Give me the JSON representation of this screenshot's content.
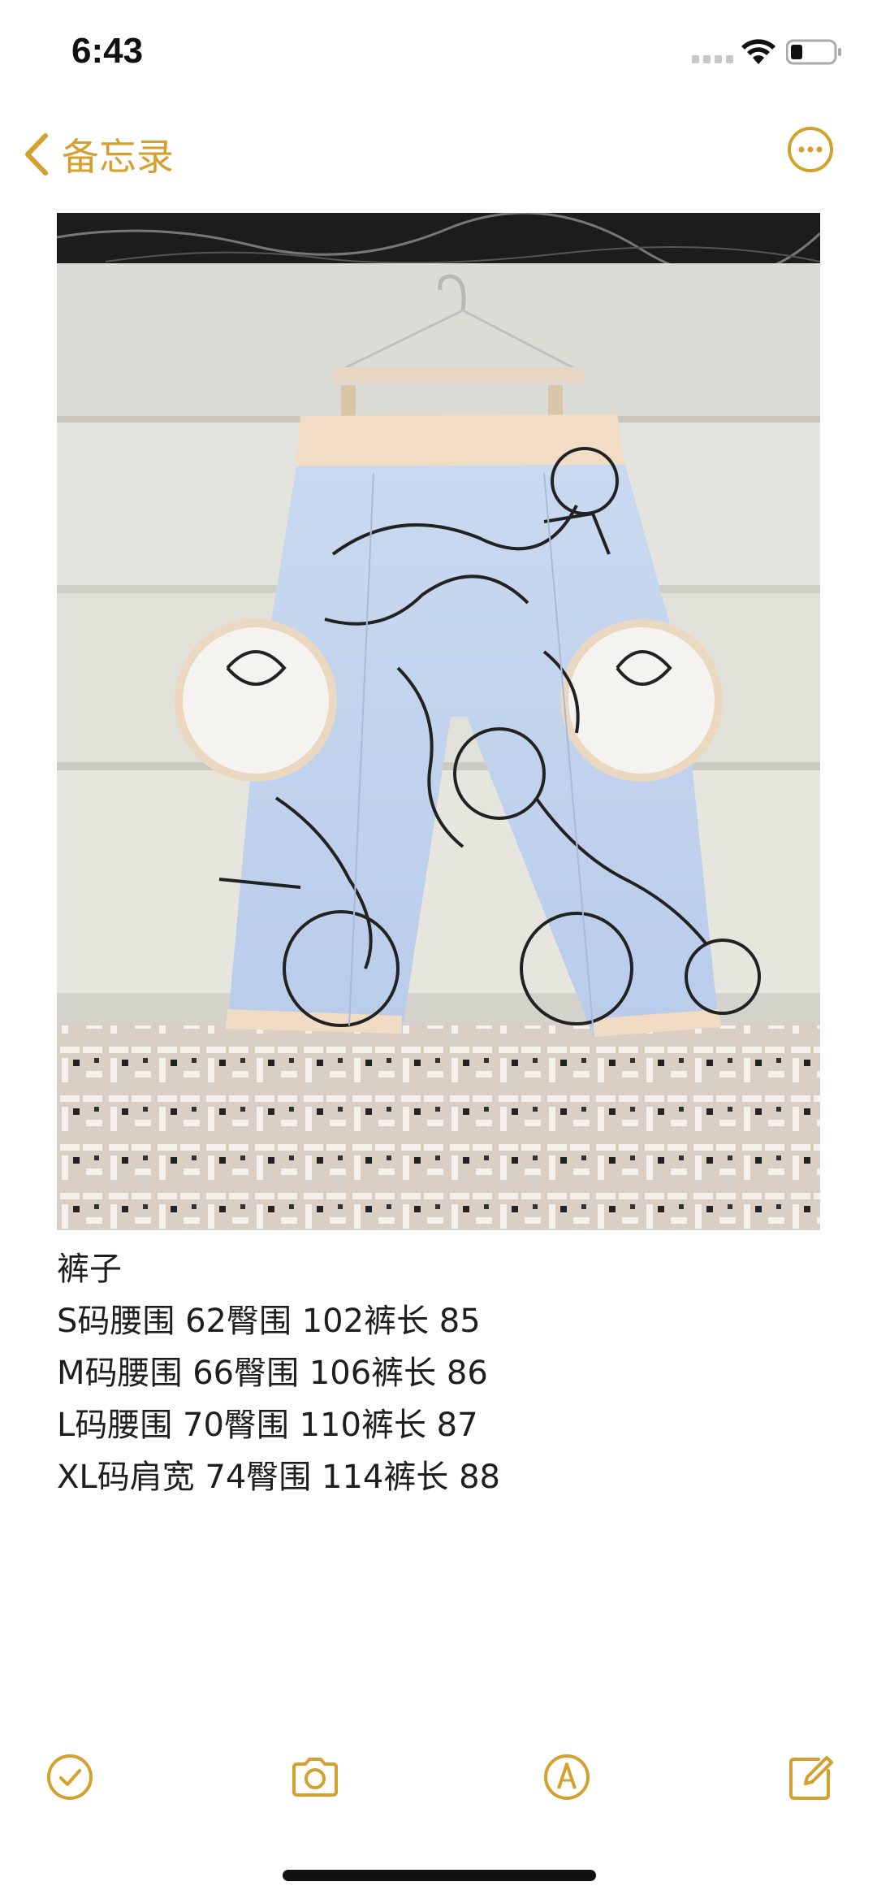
{
  "status_bar": {
    "time": "6:43",
    "icons": [
      "cellular-signal-icon",
      "wifi-icon",
      "battery-icon"
    ]
  },
  "nav": {
    "back_label": "备忘录",
    "back_icon": "chevron-left-icon",
    "more_icon": "ellipsis-circle-icon"
  },
  "note": {
    "image": {
      "description_icon": "photo-attachment"
    },
    "lines": [
      "裤子",
      "S码腰围 62臀围 102裤长 85",
      "M码腰围 66臀围 106裤长 86",
      "L码腰围 70臀围 110裤长 87",
      "XL码肩宽 74臀围 114裤长 88"
    ]
  },
  "toolbar": {
    "items": [
      "checklist-icon",
      "camera-icon",
      "markup-pen-icon",
      "compose-icon"
    ]
  },
  "colors": {
    "accent": "#d4a02e",
    "text": "#1e1e1e",
    "background": "#ffffff"
  }
}
